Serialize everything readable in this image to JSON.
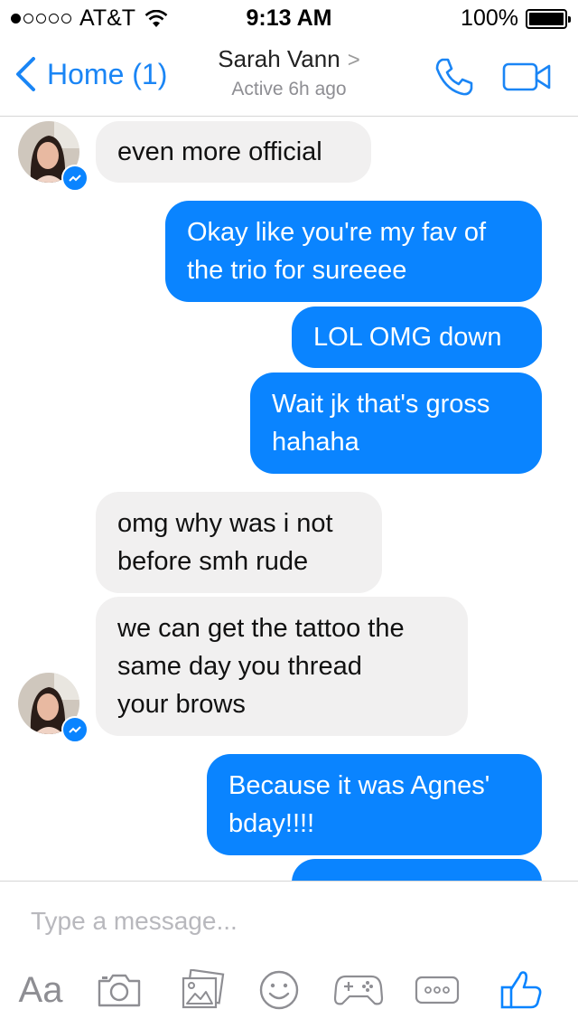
{
  "status_bar": {
    "carrier": "AT&T",
    "time": "9:13 AM",
    "battery": "100%",
    "signal_bars": 1
  },
  "nav": {
    "back_label": "Home (1)",
    "contact_name": "Sarah Vann",
    "contact_chevron": ">",
    "contact_status": "Active 6h ago"
  },
  "messages": [
    {
      "from": "them",
      "text": "even more official"
    },
    {
      "from": "me",
      "text": "Okay like you're my fav of\nthe trio for sureeee"
    },
    {
      "from": "me",
      "text": "LOL OMG down"
    },
    {
      "from": "me",
      "text": "Wait jk that's gross\nhahaha"
    },
    {
      "from": "them",
      "text": "omg why was i not\nbefore smh rude"
    },
    {
      "from": "them",
      "text": "we can get the tattoo the\nsame day you thread\nyour brows"
    },
    {
      "from": "me",
      "text": "Because it was Agnes'\nbday!!!!"
    }
  ],
  "composer": {
    "placeholder": "Type a message...",
    "aa_label": "Aa"
  },
  "icons": {
    "call": "phone-icon",
    "video": "video-camera-icon",
    "camera": "camera-icon",
    "gallery": "photo-gallery-icon",
    "emoji": "emoji-icon",
    "games": "game-controller-icon",
    "more": "more-icon",
    "like": "thumbs-up-icon"
  },
  "colors": {
    "accent": "#0a84ff",
    "incoming_bubble": "#f1f0f0",
    "icon_gray": "#8e8e93"
  }
}
